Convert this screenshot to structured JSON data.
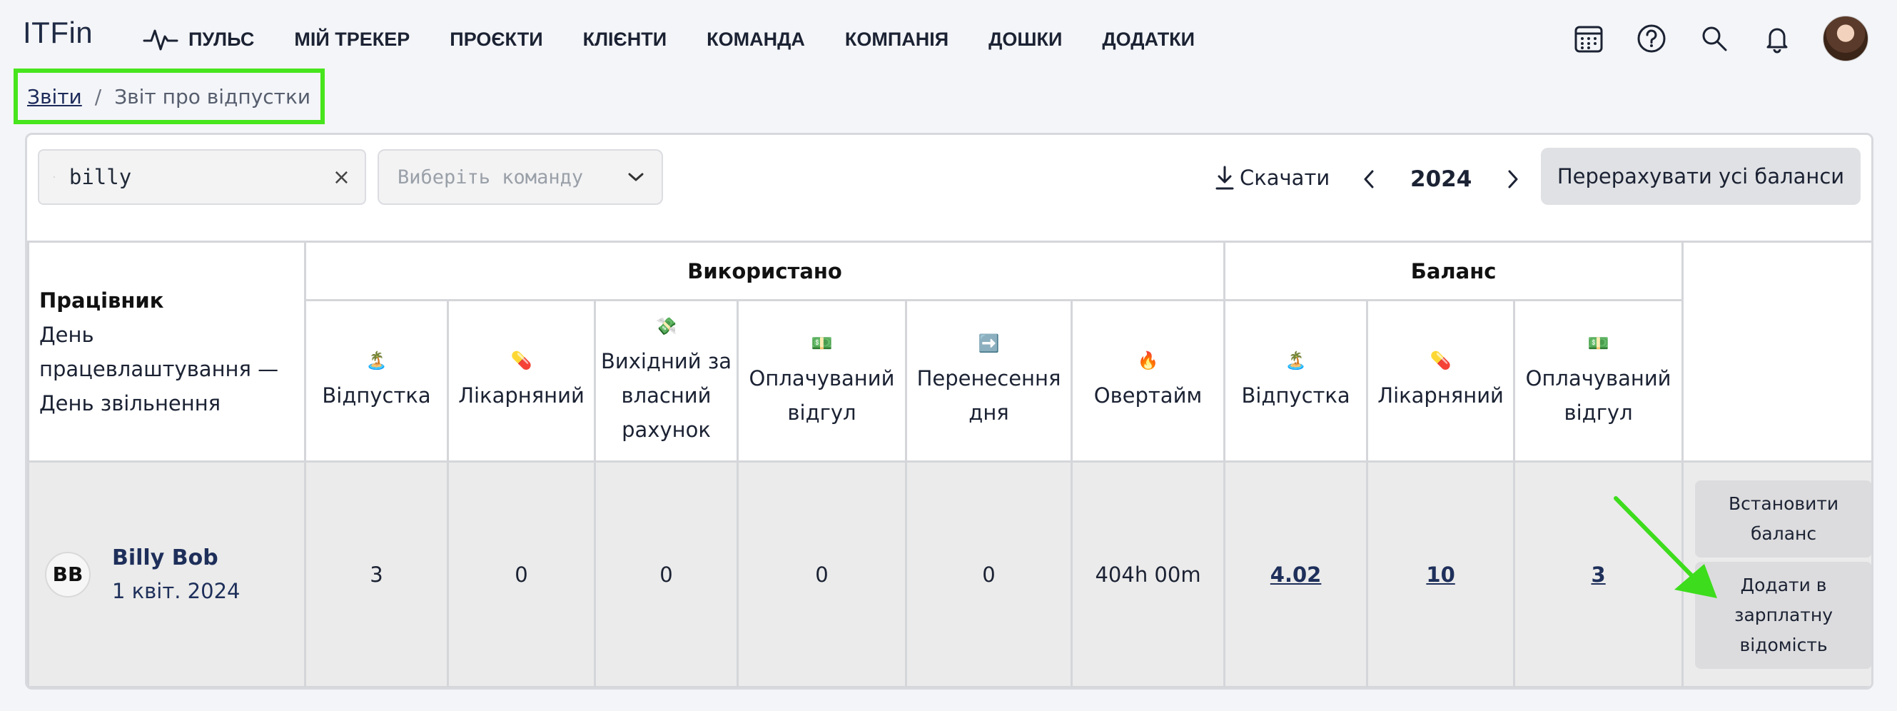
{
  "app": {
    "logo": "ITFin"
  },
  "nav": {
    "items": [
      {
        "label": "ПУЛЬС",
        "icon": "pulse-icon"
      },
      {
        "label": "МІЙ ТРЕКЕР"
      },
      {
        "label": "ПРОЄКТИ"
      },
      {
        "label": "КЛІЄНТИ"
      },
      {
        "label": "КОМАНДА"
      },
      {
        "label": "КОМПАНІЯ"
      },
      {
        "label": "ДОШКИ"
      },
      {
        "label": "ДОДАТКИ"
      }
    ],
    "right_icons": [
      "calendar-icon",
      "help-icon",
      "search-icon",
      "bell-icon",
      "avatar"
    ]
  },
  "breadcrumb": {
    "parent": "Звіти",
    "separator": "/",
    "current": "Звіт про відпустки"
  },
  "toolbar": {
    "search_value": "billy",
    "clear": "×",
    "team_placeholder": "Виберіть команду",
    "download_label": "Скачати",
    "year": "2024",
    "recalc_label": "Перерахувати усі баланси"
  },
  "table": {
    "worker_header": {
      "title": "Працівник",
      "subtitle": "День працевлаштування — День звільнення"
    },
    "used_group": "Використано",
    "balance_group": "Баланс",
    "used_columns": [
      {
        "emoji": "🏝️",
        "label": "Відпустка"
      },
      {
        "emoji": "💊",
        "label": "Лікарняний"
      },
      {
        "emoji": "💸",
        "label": "Вихідний за власний рахунок"
      },
      {
        "emoji": "💵",
        "label": "Оплачуваний відгул"
      },
      {
        "emoji": "➡️",
        "label": "Перенесення дня"
      },
      {
        "emoji": "🔥",
        "label": "Овертайм"
      }
    ],
    "balance_columns": [
      {
        "emoji": "🏝️",
        "label": "Відпустка"
      },
      {
        "emoji": "💊",
        "label": "Лікарняний"
      },
      {
        "emoji": "💵",
        "label": "Оплачуваний відгул"
      }
    ],
    "rows": [
      {
        "initials": "BB",
        "name": "Billy Bob",
        "hire_date": "1 квіт. 2024",
        "used": [
          "3",
          "0",
          "0",
          "0",
          "0",
          "404h 00m"
        ],
        "balance": [
          "4.02",
          "10",
          "3"
        ],
        "actions": {
          "set_balance": "Встановити баланс",
          "add_payroll": "Додати в зарплатну відомість"
        }
      }
    ]
  },
  "colors": {
    "highlight": "#47e51d",
    "accent_arrow": "#3ddc1c",
    "link": "#1e2f5a"
  }
}
